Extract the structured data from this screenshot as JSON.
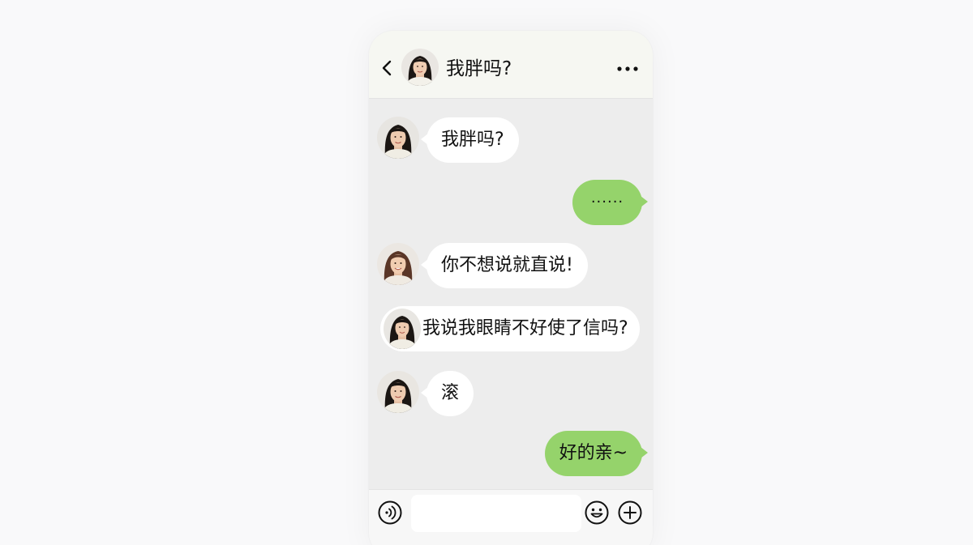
{
  "header": {
    "title": "我胖吗?",
    "avatar_icon": "girl-avatar-icon",
    "back_icon": "chevron-left-icon",
    "more_icon": "more-dots-icon"
  },
  "messages": [
    {
      "side": "in",
      "text": "我胖吗?",
      "avatar": "girl-avatar"
    },
    {
      "side": "out",
      "text": "······"
    },
    {
      "side": "in",
      "text": "你不想说就直说!",
      "avatar": "girl-avatar-alt"
    },
    {
      "side": "in",
      "text": "我说我眼睛不好使了信吗?",
      "avatar": "girl-avatar",
      "avatar_inside_bubble": true
    },
    {
      "side": "in",
      "text": "滚",
      "avatar": "girl-avatar"
    },
    {
      "side": "out",
      "text": "好的亲~"
    }
  ],
  "input_bar": {
    "text_value": "",
    "placeholder": "",
    "voice_icon": "voice-icon",
    "emoji_icon": "emoji-icon",
    "plus_icon": "plus-icon"
  },
  "colors": {
    "outgoing_bubble": "#95d36b",
    "incoming_bubble": "#ffffff",
    "chat_background": "#ededed",
    "header_background": "#f6f7f2"
  }
}
